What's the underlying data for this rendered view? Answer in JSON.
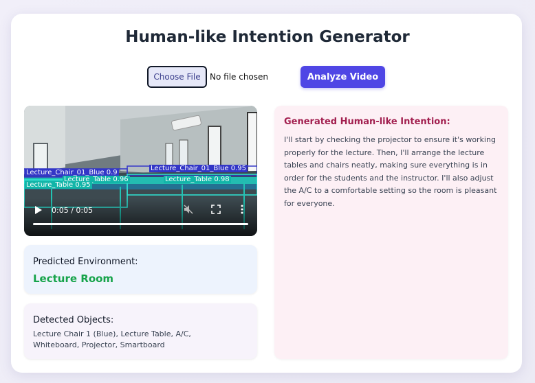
{
  "header": {
    "title": "Human-like Intention Generator"
  },
  "upload": {
    "choose_label": "Choose File",
    "status": "No file chosen"
  },
  "actions": {
    "analyze_label": "Analyze Video"
  },
  "video": {
    "time": "0:05 / 0:05",
    "progress": 1.0,
    "detections": [
      "Lecture_Chair_01_Blue 0.9",
      "Lecture_Chair_01_Blue 0.95",
      "Lecture_Table 0.96",
      "Lecture_Table 0.98",
      "Lecture_Table 0.95"
    ]
  },
  "environment": {
    "label": "Predicted Environment:",
    "value": "Lecture Room"
  },
  "objects": {
    "label": "Detected Objects:",
    "value": "Lecture Chair 1 (Blue), Lecture Table, A/C, Whiteboard, Projector, Smartboard"
  },
  "intention": {
    "title": "Generated Human-like Intention:",
    "text": "I'll start by checking the projector to ensure it's working properly for the lecture. Then, I'll arrange the lecture tables and chairs neatly, making sure everything is in order for the students and the instructor. I'll also adjust the A/C to a comfortable setting so the room is pleasant for everyone."
  },
  "colors": {
    "accent": "#4f46e5",
    "environment_value": "#16a34a",
    "intention_title": "#a21f4f"
  }
}
